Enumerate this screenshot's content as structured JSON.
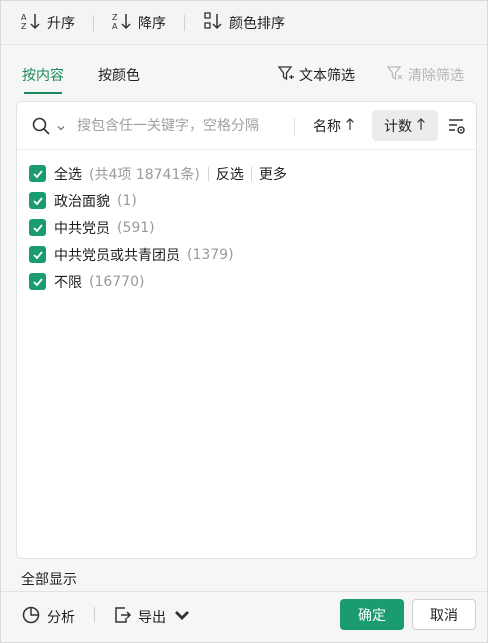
{
  "sort_bar": {
    "ascending_label": "升序",
    "descending_label": "降序",
    "color_sort_label": "颜色排序"
  },
  "tabs": {
    "by_content": "按内容",
    "by_color": "按颜色",
    "text_filter": "文本筛选",
    "clear_filter": "清除筛选"
  },
  "search": {
    "placeholder": "搜包含任一关键字，空格分隔",
    "sort_name_label": "名称",
    "sort_count_label": "计数"
  },
  "list": {
    "select_all": {
      "label": "全选",
      "count": "(共4项 18741条)",
      "invert": "反选",
      "more": "更多"
    },
    "items": [
      {
        "label": "政治面貌",
        "count": "(1)"
      },
      {
        "label": "中共党员",
        "count": "(591)"
      },
      {
        "label": "中共党员或共青团员",
        "count": "(1379)"
      },
      {
        "label": "不限",
        "count": "(16770)"
      }
    ]
  },
  "footer": {
    "show_all": "全部显示",
    "analyze": "分析",
    "export": "导出",
    "ok": "确定",
    "cancel": "取消"
  },
  "colors": {
    "accent": "#1a9c6e",
    "tab_active": "#1a8a5a"
  }
}
